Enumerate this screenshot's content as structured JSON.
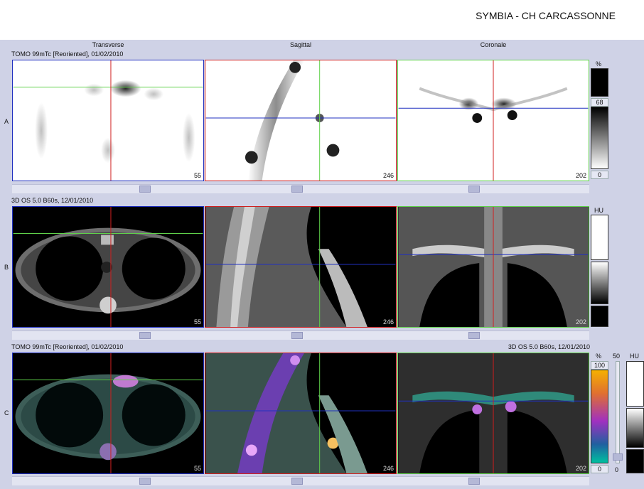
{
  "header": {
    "title": "SYMBIA - CH CARCASSONNE"
  },
  "columns": [
    "Transverse",
    "Sagittal",
    "Coronale"
  ],
  "rows": [
    {
      "letter": "A",
      "study_left": "TOMO 99mTc [Reoriented], 01/02/2010",
      "study_right": "",
      "slices": [
        "55",
        "246",
        "202"
      ],
      "scale_unit": "%",
      "scale_max": "68",
      "scale_min": "0"
    },
    {
      "letter": "B",
      "study_left": "3D  OS  5.0  B60s, 12/01/2010",
      "study_right": "",
      "slices": [
        "55",
        "246",
        "202"
      ],
      "scale_unit": "HU",
      "scale_max": "",
      "scale_min": ""
    },
    {
      "letter": "C",
      "study_left": "TOMO 99mTc [Reoriented], 01/02/2010",
      "study_right": "3D  OS  5.0  B60s, 12/01/2010",
      "slices": [
        "55",
        "246",
        "202"
      ],
      "scale_unit": "%",
      "scale_max": "100",
      "scale_min": "0"
    }
  ],
  "fusion": {
    "blend_label": "50",
    "blend_min": "0",
    "ct_unit": "HU"
  },
  "colors": {
    "axial_line": "#5fd14a",
    "sagittal_line": "#d02020",
    "coronal_line": "#2030c0",
    "frame_axial": "#2030c0",
    "frame_sagittal": "#d02020",
    "frame_coronal": "#5fd14a"
  },
  "images": {
    "A": [
      "spect-transverse-image",
      "spect-sagittal-image",
      "spect-coronal-image"
    ],
    "B": [
      "ct-transverse-image",
      "ct-sagittal-image",
      "ct-coronal-image"
    ],
    "C": [
      "fused-transverse-image",
      "fused-sagittal-image",
      "fused-coronal-image"
    ]
  }
}
